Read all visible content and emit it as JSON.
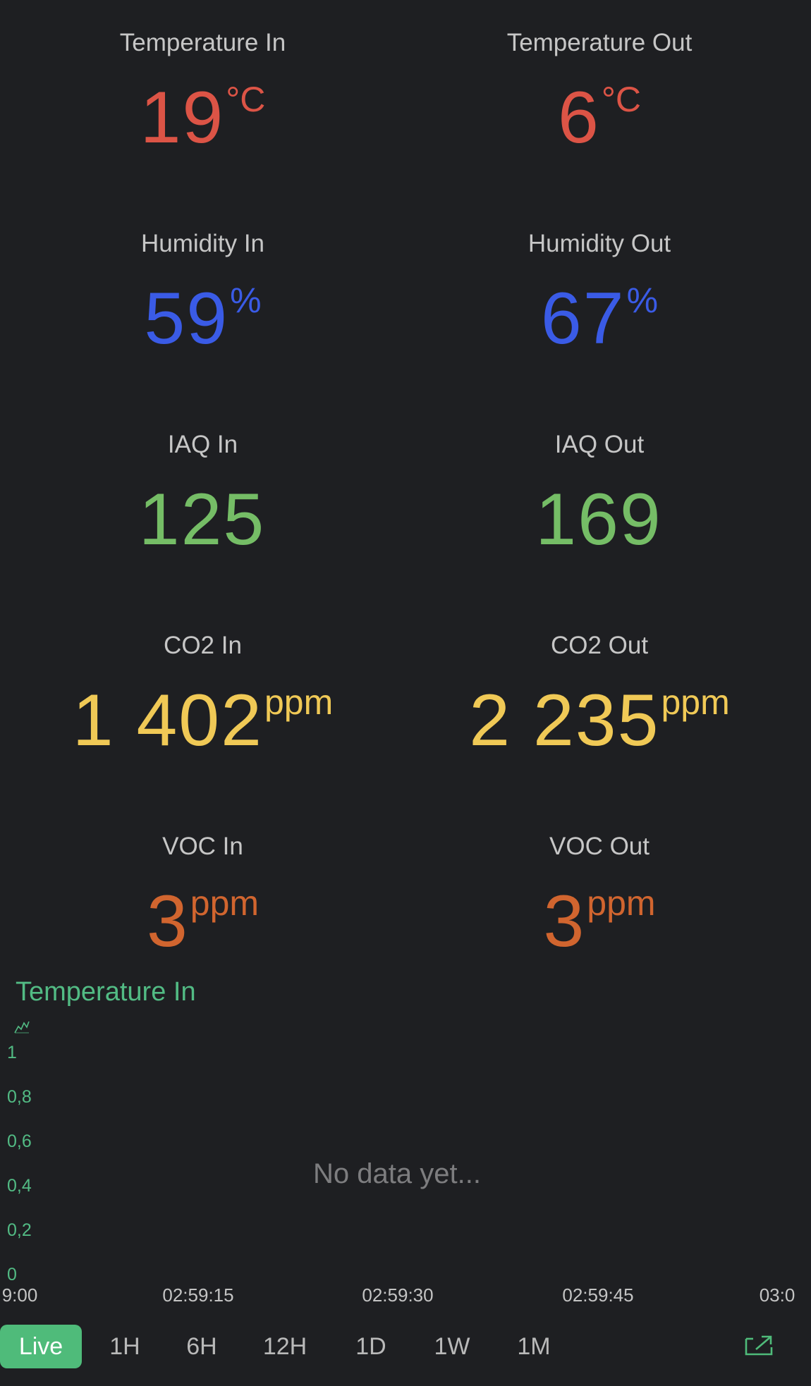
{
  "colors": {
    "background": "#1e1f22",
    "temperature": "#dc5446",
    "humidity": "#3a5be6",
    "iaq": "#75bd66",
    "co2": "#f0c956",
    "voc": "#d1652f",
    "accent": "#52bb84"
  },
  "tiles": [
    {
      "label": "Temperature In",
      "value": "19",
      "unit": "°C"
    },
    {
      "label": "Temperature Out",
      "value": "6",
      "unit": "°C"
    },
    {
      "label": "Humidity In",
      "value": "59",
      "unit": "%"
    },
    {
      "label": "Humidity Out",
      "value": "67",
      "unit": "%"
    },
    {
      "label": "IAQ In",
      "value": "125",
      "unit": ""
    },
    {
      "label": "IAQ Out",
      "value": "169",
      "unit": ""
    },
    {
      "label": "CO2 In",
      "value": "1 402",
      "unit": "ppm"
    },
    {
      "label": "CO2 Out",
      "value": "2 235",
      "unit": "ppm"
    },
    {
      "label": "VOC In",
      "value": "3",
      "unit": "ppm"
    },
    {
      "label": "VOC Out",
      "value": "3",
      "unit": "ppm"
    }
  ],
  "chart": {
    "title": "Temperature In",
    "icon": "line-chart-icon",
    "empty_message": "No data yet..."
  },
  "chart_data": {
    "type": "line",
    "title": "Temperature In",
    "xlabel": "",
    "ylabel": "",
    "x_ticks": [
      "9:00",
      "02:59:15",
      "02:59:30",
      "02:59:45",
      "03:0"
    ],
    "y_ticks": [
      "1",
      "0,8",
      "0,6",
      "0,4",
      "0,2",
      "0"
    ],
    "ylim": [
      0,
      1
    ],
    "series": [],
    "grid": false
  },
  "ranges": {
    "items": [
      "Live",
      "1H",
      "6H",
      "12H",
      "1D",
      "1W",
      "1M"
    ],
    "active": "Live",
    "export_icon": "open-external-icon"
  }
}
